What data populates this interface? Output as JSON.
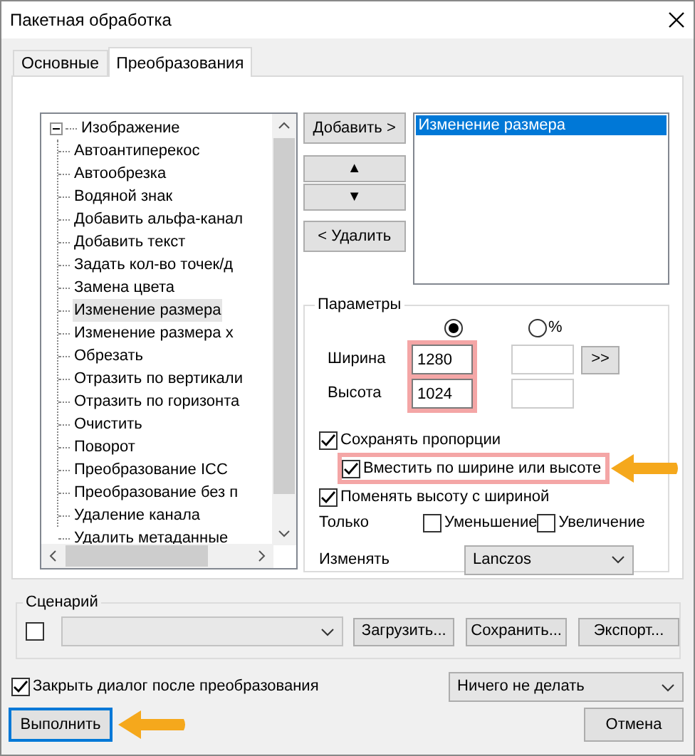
{
  "window": {
    "title": "Пакетная обработка"
  },
  "tabs": [
    {
      "label": "Основные",
      "selected": false
    },
    {
      "label": "Преобразования",
      "selected": true
    }
  ],
  "tree": {
    "label": "Изображение",
    "expanded": true,
    "children": [
      {
        "label": "Автоантиперекос",
        "selected": false
      },
      {
        "label": "Автообрезка",
        "selected": false
      },
      {
        "label": "Водяной знак",
        "selected": false
      },
      {
        "label": "Добавить альфа-канал",
        "selected": false
      },
      {
        "label": "Добавить текст",
        "selected": false
      },
      {
        "label": "Задать кол-во точек/д",
        "selected": false
      },
      {
        "label": "Замена цвета",
        "selected": false
      },
      {
        "label": "Изменение размера",
        "selected": true
      },
      {
        "label": "Изменение размера х",
        "selected": false
      },
      {
        "label": "Обрезать",
        "selected": false
      },
      {
        "label": "Отразить по вертикали",
        "selected": false
      },
      {
        "label": "Отразить по горизонта",
        "selected": false
      },
      {
        "label": "Очистить",
        "selected": false
      },
      {
        "label": "Поворот",
        "selected": false
      },
      {
        "label": "Преобразование ICC",
        "selected": false
      },
      {
        "label": "Преобразование без п",
        "selected": false
      },
      {
        "label": "Удаление канала",
        "selected": false
      },
      {
        "label": "Удалить метаданные",
        "selected": false
      }
    ]
  },
  "actions": {
    "add": "Добавить >",
    "up": "▲",
    "down": "▼",
    "remove": "< Удалить"
  },
  "applied": [
    {
      "label": "Изменение размера",
      "selected": true
    }
  ],
  "parameters": {
    "title": "Параметры",
    "modes": [
      {
        "selected": true
      },
      {
        "label": "%",
        "selected": false
      }
    ],
    "fields": [
      {
        "label": "Ширина",
        "value": "1280",
        "highlighted": true
      },
      {
        "label": "Высота",
        "value": "1024",
        "highlighted": true
      }
    ],
    "copy_button": ">>",
    "options": [
      {
        "label": "Сохранять пропорции",
        "checked": true,
        "highlighted": false,
        "callout": false,
        "children": [
          {
            "label": "Вместить по ширине или высоте",
            "checked": true,
            "highlighted": true,
            "callout": true
          }
        ]
      },
      {
        "label": "Поменять высоту с шириной",
        "checked": true,
        "highlighted": false,
        "callout": false
      }
    ],
    "only": {
      "label": "Только",
      "options": [
        {
          "label": "Уменьшение",
          "checked": false
        },
        {
          "label": "Увеличение",
          "checked": false
        }
      ]
    },
    "resize": {
      "label": "Изменять",
      "value": "Lanczos"
    }
  },
  "scenario": {
    "title": "Сценарий",
    "checked": false,
    "buttons": [
      "Загрузить...",
      "Сохранить...",
      "Экспорт..."
    ]
  },
  "close_after": {
    "label": "Закрыть диалог после преобразования",
    "checked": true
  },
  "after_action": {
    "value": "Ничего не делать"
  },
  "run": {
    "label": "Выполнить",
    "callout": true
  },
  "cancel": {
    "label": "Отмена"
  }
}
